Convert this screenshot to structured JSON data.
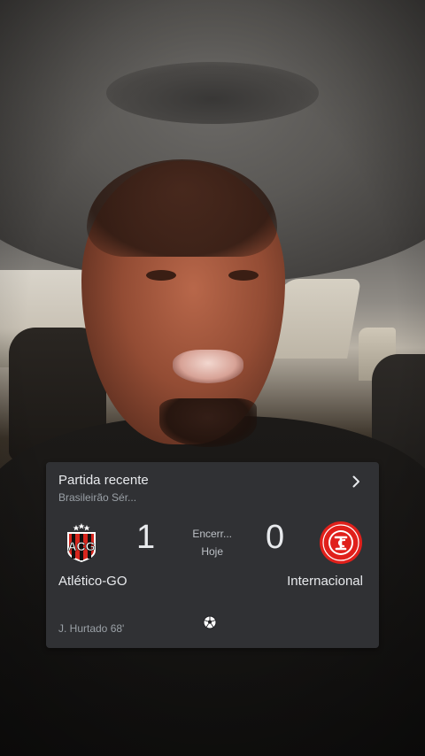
{
  "match_card": {
    "title": "Partida recente",
    "competition": "Brasileirão Sér...",
    "status": "Encerr...",
    "date": "Hoje",
    "home": {
      "name": "Atlético-GO",
      "score": "1",
      "logo_icon": "atletico-go-crest-icon",
      "colors": {
        "primary": "#d7261e",
        "secondary": "#111111"
      }
    },
    "away": {
      "name": "Internacional",
      "score": "0",
      "logo_icon": "internacional-crest-icon",
      "colors": {
        "primary": "#e0201b",
        "secondary": "#ffffff"
      }
    },
    "goals": [
      {
        "scorer": "J. Hurtado 68'",
        "team": "home",
        "icon": "soccer-ball-icon"
      }
    ],
    "chevron_icon": "chevron-right-icon",
    "background": "#303134",
    "text_color": "#e8eaed",
    "muted_color": "#9aa0a6"
  }
}
